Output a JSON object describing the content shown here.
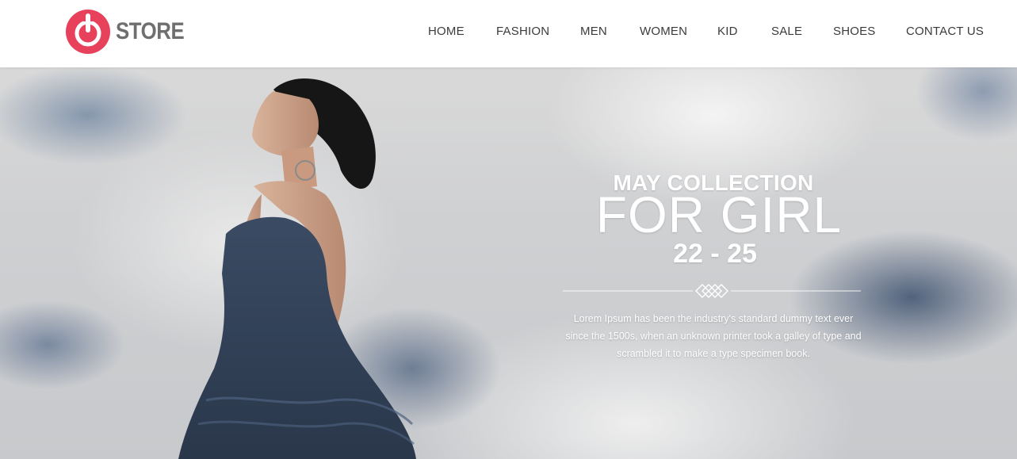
{
  "brand": {
    "name": "STORE",
    "color": "#e8415b"
  },
  "nav": {
    "items": [
      {
        "label": "HOME"
      },
      {
        "label": "FASHION"
      },
      {
        "label": "MEN"
      },
      {
        "label": "WOMEN"
      },
      {
        "label": "KID"
      },
      {
        "label": "SALE"
      },
      {
        "label": "SHOES"
      },
      {
        "label": "CONTACT US"
      }
    ]
  },
  "hero": {
    "subtitle": "MAY COLLECTION",
    "title": "FOR GIRL",
    "range": "22 - 25",
    "description": "Lorem Ipsum has been the industry's standard dummy text ever since the 1500s, when an unknown printer took a galley of type and scrambled it to make a type specimen book."
  }
}
